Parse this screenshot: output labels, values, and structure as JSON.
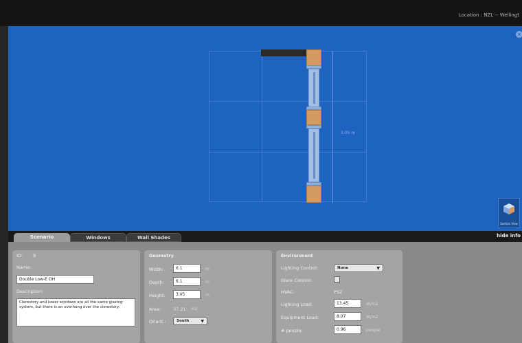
{
  "header": {
    "location_label": "Location : NZL -- Wellingt"
  },
  "viewport": {
    "dimension_label": "3.05 m",
    "close_glyph": "×",
    "section_view_label": "Section View"
  },
  "tabs": [
    {
      "label": "Scenario"
    },
    {
      "label": "Windows"
    },
    {
      "label": "Wall Shades"
    }
  ],
  "hide_info_label": "hide info",
  "scenario": {
    "id_label": "ID:",
    "id_value": "9",
    "name_label": "Name:",
    "name_value": "Double Low-E OH",
    "description_label": "Description:",
    "description_value": "Clerestory and lower windows are all the same glazing system, but there is an overhang over the clerestory."
  },
  "geometry": {
    "heading": "Geometry",
    "width_label": "Width:",
    "width_value": "6.1",
    "width_unit": "m",
    "depth_label": "Depth:",
    "depth_value": "6.1",
    "depth_unit": "m",
    "height_label": "Height:",
    "height_value": "3.05",
    "height_unit": "m",
    "area_label": "Area:",
    "area_value": "37.21",
    "area_unit": "m2",
    "orient_label": "Orient.:",
    "orient_value": "South"
  },
  "environment": {
    "heading": "Environment",
    "lighting_control_label": "Lighting Control:",
    "lighting_control_value": "None",
    "glare_control_label": "Glare Control:",
    "hvac_label": "HVAC:",
    "hvac_value": "PSZ",
    "lighting_load_label": "Lighting Load:",
    "lighting_load_value": "13.45",
    "lighting_load_unit": "W/m2",
    "equipment_load_label": "Equipment Load:",
    "equipment_load_value": "8.07",
    "equipment_load_unit": "W/m2",
    "people_label": "# people:",
    "people_value": "0.96",
    "people_unit": "people"
  }
}
